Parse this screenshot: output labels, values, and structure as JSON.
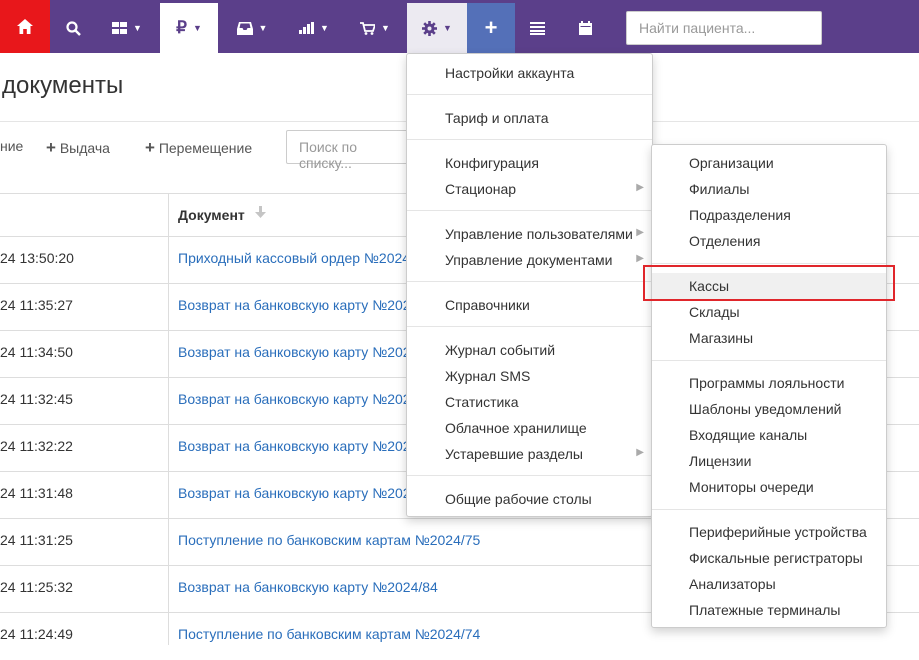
{
  "navbar": {
    "search_placeholder": "Найти пациента...",
    "icons": {
      "home": "home-icon",
      "search": "search-icon",
      "grid": "grid-icon",
      "ruble": "ruble-icon",
      "inbox": "inbox-icon",
      "chart": "chart-icon",
      "cart": "cart-icon",
      "gear": "gear-icon",
      "plus": "plus-icon",
      "list": "list-icon",
      "calendar": "calendar-icon"
    },
    "colors": {
      "bar": "#5b3f8a",
      "home": "#e8171b",
      "plus": "#5470b8"
    }
  },
  "page": {
    "title": "документы",
    "toolbar": {
      "left_fragment": "ние",
      "issue": "Выдача",
      "move": "Перемещение",
      "search_placeholder": "Поиск по списку..."
    }
  },
  "table": {
    "doc_header": "Документ",
    "rows": [
      {
        "date": "24 13:50:20",
        "doc": "Приходный кассовый ордер №2024"
      },
      {
        "date": "24 11:35:27",
        "doc": "Возврат на банковскую карту №202"
      },
      {
        "date": "24 11:34:50",
        "doc": "Возврат на банковскую карту №202"
      },
      {
        "date": "24 11:32:45",
        "doc": "Возврат на банковскую карту №202"
      },
      {
        "date": "24 11:32:22",
        "doc": "Возврат на банковскую карту №202"
      },
      {
        "date": "24 11:31:48",
        "doc": "Возврат на банковскую карту №202"
      },
      {
        "date": "24 11:31:25",
        "doc": "Поступление по банковским картам №2024/75"
      },
      {
        "date": "24 11:25:32",
        "doc": "Возврат на банковскую карту №2024/84"
      },
      {
        "date": "24 11:24:49",
        "doc": "Поступление по банковским картам №2024/74"
      }
    ]
  },
  "settings_menu": {
    "items": [
      "Настройки аккаунта",
      "Тариф и оплата",
      "Конфигурация",
      "Стационар",
      "Управление пользователями",
      "Управление документами",
      "Справочники",
      "Журнал событий",
      "Журнал SMS",
      "Статистика",
      "Облачное хранилище",
      "Устаревшие разделы",
      "Общие рабочие столы"
    ]
  },
  "config_menu": {
    "items": [
      "Организации",
      "Филиалы",
      "Подразделения",
      "Отделения",
      "Кассы",
      "Склады",
      "Магазины",
      "Программы лояльности",
      "Шаблоны уведомлений",
      "Входящие каналы",
      "Лицензии",
      "Мониторы очереди",
      "Периферийные устройства",
      "Фискальные регистраторы",
      "Анализаторы",
      "Платежные терминалы"
    ],
    "highlighted": "Кассы",
    "highlight_color": "#e0262b"
  }
}
